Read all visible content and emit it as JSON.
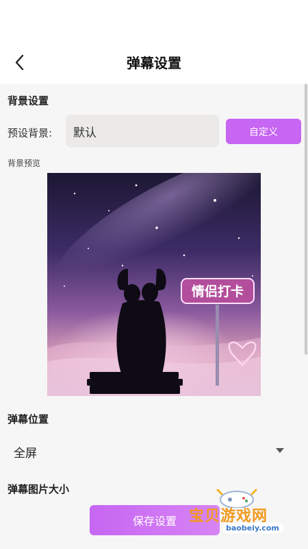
{
  "header": {
    "title": "弹幕设置"
  },
  "background_settings": {
    "section_title": "背景设置",
    "preset_label": "预设背景:",
    "preset_value": "默认",
    "custom_button": "自定义",
    "preview_label": "背景预览",
    "preview_sign_text": "情侣打卡"
  },
  "danmaku_position": {
    "section_title": "弹幕位置",
    "selected_value": "全屏"
  },
  "image_size": {
    "section_title": "弹幕图片大小"
  },
  "save_button": "保存设置",
  "watermark": {
    "brand": "宝贝游戏网",
    "url": "baobeiy.com"
  },
  "colors": {
    "accent": "#c766f2",
    "page_bg": "#f6f6f6",
    "field_bg": "#ebeae8"
  },
  "icons": {
    "back": "chevron-left-icon",
    "dropdown": "caret-down-icon"
  }
}
